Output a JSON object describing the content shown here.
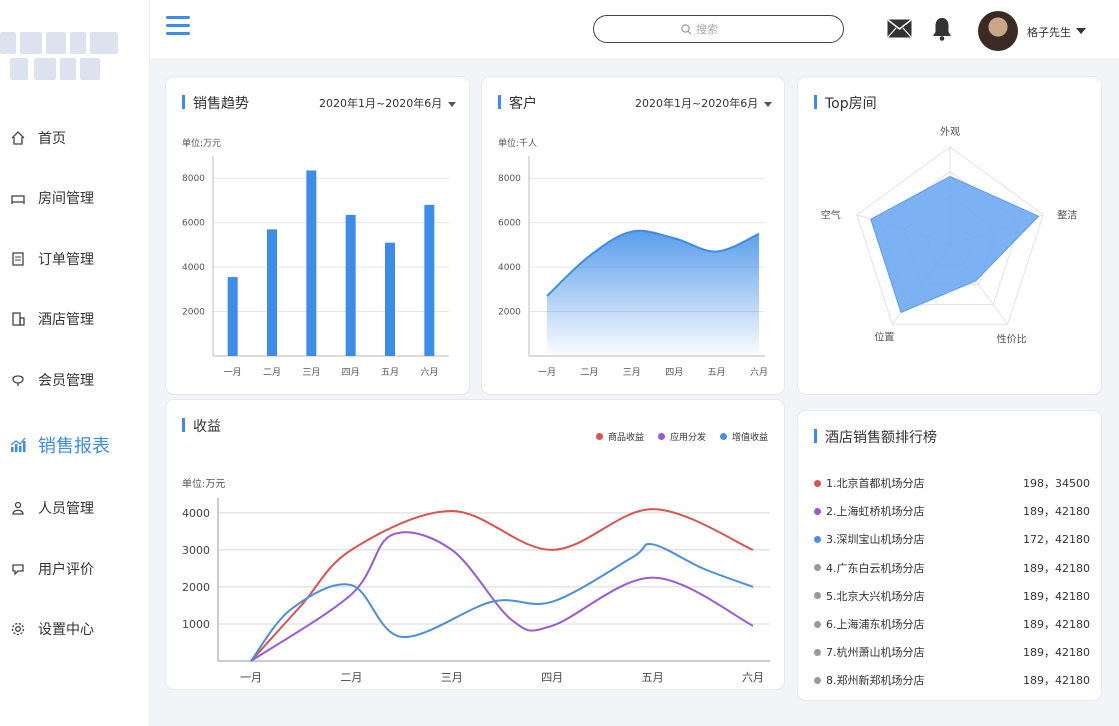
{
  "sidebar": {
    "items": [
      {
        "label": "首页",
        "icon": "home-icon"
      },
      {
        "label": "房间管理",
        "icon": "bed-icon"
      },
      {
        "label": "订单管理",
        "icon": "order-icon"
      },
      {
        "label": "酒店管理",
        "icon": "building-icon"
      },
      {
        "label": "会员管理",
        "icon": "member-icon"
      },
      {
        "label": "销售报表",
        "icon": "chart-icon",
        "active": true
      },
      {
        "label": "人员管理",
        "icon": "person-icon"
      },
      {
        "label": "用户评价",
        "icon": "review-icon"
      },
      {
        "label": "设置中心",
        "icon": "gear-icon"
      }
    ]
  },
  "header": {
    "search_placeholder": "搜索",
    "user_name": "格子先生"
  },
  "colors": {
    "accent": "#3d8ce8",
    "red": "#d9534f",
    "purple": "#9b59d6",
    "blue": "#4a90d9",
    "gray": "#999999"
  },
  "sales": {
    "title": "销售趋势",
    "range": "2020年1月~2020年6月",
    "unit": "单位:万元"
  },
  "customers": {
    "title": "客户",
    "range": "2020年1月~2020年6月",
    "unit": "单位:千人"
  },
  "top_rooms": {
    "title": "Top房间"
  },
  "revenue": {
    "title": "收益",
    "unit": "单位:万元"
  },
  "ranking": {
    "title": "酒店销售额排行榜",
    "items": [
      {
        "name": "1.北京首都机场分店",
        "value": "198，34500",
        "color": "#d9534f"
      },
      {
        "name": "2.上海虹桥机场分店",
        "value": "189，42180",
        "color": "#9b59d6"
      },
      {
        "name": "3.深圳宝山机场分店",
        "value": "172，42180",
        "color": "#4a90d9"
      },
      {
        "name": "4.广东白云机场分店",
        "value": "189，42180",
        "color": "#999999"
      },
      {
        "name": "5.北京大兴机场分店",
        "value": "189，42180",
        "color": "#999999"
      },
      {
        "name": "6.上海浦东机场分店",
        "value": "189，42180",
        "color": "#999999"
      },
      {
        "name": "7.杭州萧山机场分店",
        "value": "189，42180",
        "color": "#999999"
      },
      {
        "name": "8.郑州新郑机场分店",
        "value": "189，42180",
        "color": "#999999"
      }
    ]
  },
  "chart_data": [
    {
      "type": "bar",
      "categories": [
        "一月",
        "二月",
        "三月",
        "四月",
        "五月",
        "六月"
      ],
      "values": [
        3550,
        5700,
        8350,
        6350,
        5100,
        6800
      ],
      "yticks": [
        2000,
        4000,
        6000,
        8000
      ],
      "ylim": [
        0,
        9000
      ],
      "grid": true
    },
    {
      "type": "area",
      "categories": [
        "一月",
        "二月",
        "三月",
        "四月",
        "五月",
        "六月"
      ],
      "values": [
        2700,
        4500,
        5600,
        5300,
        4700,
        5500
      ],
      "yticks": [
        2000,
        4000,
        6000,
        8000
      ],
      "ylim": [
        0,
        9000
      ],
      "grid": true
    },
    {
      "type": "radar",
      "indicators": [
        "外观",
        "整洁",
        "性价比",
        "位置",
        "空气"
      ],
      "values": [
        0.7,
        0.95,
        0.45,
        0.85,
        0.85
      ]
    },
    {
      "type": "line",
      "categories": [
        "一月",
        "二月",
        "三月",
        "四月",
        "五月",
        "六月"
      ],
      "yticks": [
        1000,
        2000,
        3000,
        4000
      ],
      "ylim": [
        0,
        4400
      ],
      "grid": true,
      "legend_position": "top-right",
      "series": [
        {
          "name": "商品收益",
          "color": "#d9534f",
          "points": [
            [
              0,
              0
            ],
            [
              0.5,
              1500
            ],
            [
              1,
              3000
            ],
            [
              2,
              4050
            ],
            [
              3,
              3000
            ],
            [
              4,
              4100
            ],
            [
              5,
              3000
            ]
          ]
        },
        {
          "name": "应用分发",
          "color": "#9b59d6",
          "points": [
            [
              0,
              0
            ],
            [
              1,
              1800
            ],
            [
              1.4,
              3400
            ],
            [
              2,
              3000
            ],
            [
              2.6,
              1100
            ],
            [
              3,
              950
            ],
            [
              4,
              2250
            ],
            [
              5,
              950
            ]
          ]
        },
        {
          "name": "增值收益",
          "color": "#4a90d9",
          "points": [
            [
              0,
              0
            ],
            [
              0.4,
              1400
            ],
            [
              1,
              2050
            ],
            [
              1.5,
              650
            ],
            [
              2.4,
              1600
            ],
            [
              3,
              1600
            ],
            [
              3.8,
              2800
            ],
            [
              4,
              3150
            ],
            [
              4.5,
              2500
            ],
            [
              5,
              2000
            ]
          ]
        }
      ]
    }
  ]
}
